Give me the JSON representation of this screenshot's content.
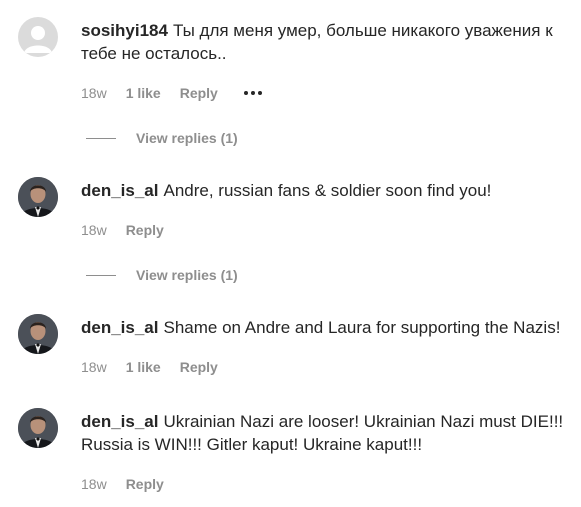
{
  "comments": [
    {
      "username": "sosihyi184",
      "text": "Ты для меня умер, больше никакого уважения к тебе не осталось..",
      "time": "18w",
      "likes": "1 like",
      "reply": "Reply",
      "avatar": "default-avatar-icon",
      "view_replies": "View replies (1)"
    },
    {
      "username": "den_is_al",
      "text": "Andre, russian fans & soldier soon find you!",
      "time": "18w",
      "likes": "",
      "reply": "Reply",
      "avatar": "profile-photo",
      "view_replies": "View replies (1)"
    },
    {
      "username": "den_is_al",
      "text": "Shame on Andre and Laura for supporting the Nazis!",
      "time": "18w",
      "likes": "1 like",
      "reply": "Reply",
      "avatar": "profile-photo"
    },
    {
      "username": "den_is_al",
      "text": "Ukrainian Nazi are looser! Ukrainian Nazi must DIE!!! Russia is WIN!!! Gitler kaput! Ukraine kaput!!!",
      "time": "18w",
      "likes": "",
      "reply": "Reply",
      "avatar": "profile-photo"
    }
  ],
  "colors": {
    "text": "#262626",
    "meta": "#8e8e8e",
    "placeholder_avatar": "#dbdbdb"
  }
}
